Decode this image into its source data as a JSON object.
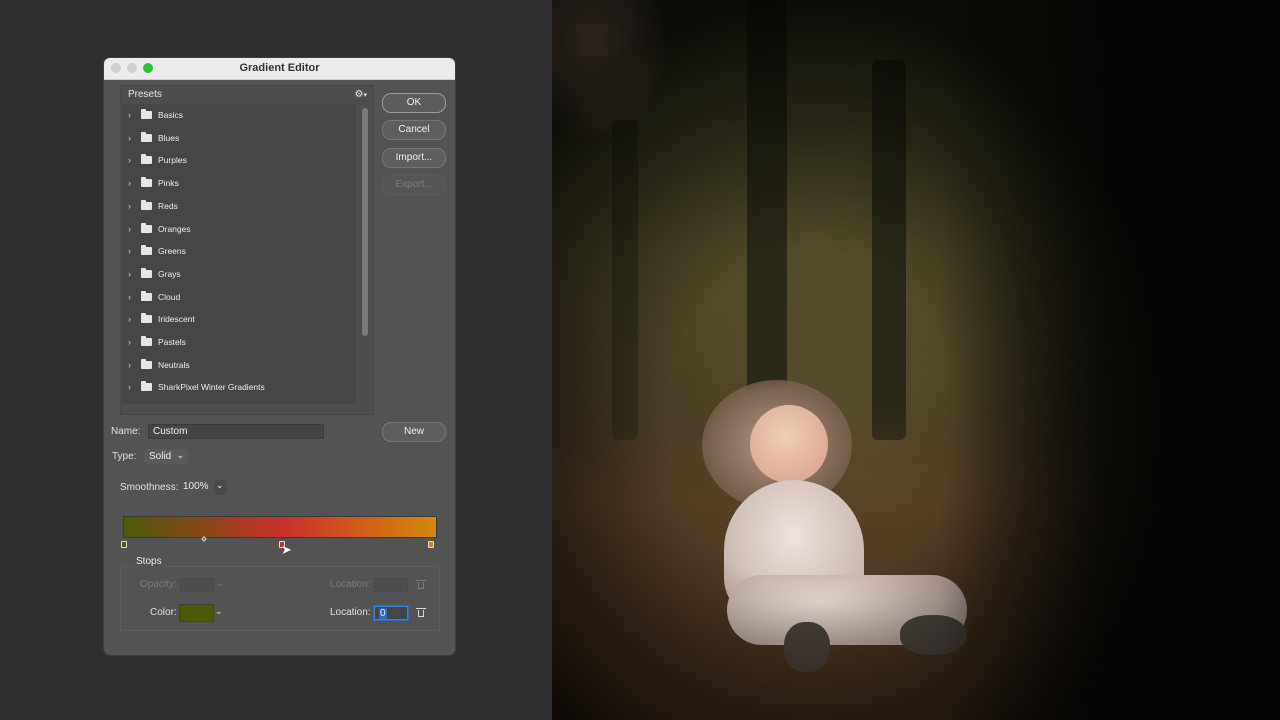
{
  "dialog": {
    "title": "Gradient Editor",
    "presets_label": "Presets",
    "presets": [
      "Basics",
      "Blues",
      "Purples",
      "Pinks",
      "Reds",
      "Oranges",
      "Greens",
      "Grays",
      "Cloud",
      "Iridescent",
      "Pastels",
      "Neutrals",
      "SharkPixel Winter Gradients"
    ],
    "buttons": {
      "ok": "OK",
      "cancel": "Cancel",
      "import": "Import...",
      "export": "Export...",
      "new": "New"
    },
    "name_label": "Name:",
    "name_value": "Custom",
    "type_label": "Type:",
    "type_value": "Solid",
    "smoothness_label": "Smoothness:",
    "smoothness_value": "100%",
    "gradient_colors": [
      "#4c5a08",
      "#c9312a",
      "#d5890c"
    ],
    "stops_label": "Stops",
    "opacity_label": "Opacity:",
    "location_label": "Location:",
    "color_label": "Color:",
    "color_value": "#4c5a08",
    "location_value": "0"
  },
  "icons": {
    "gear": "⚙",
    "chevron_right": "›",
    "chevron_down": "⌄"
  }
}
